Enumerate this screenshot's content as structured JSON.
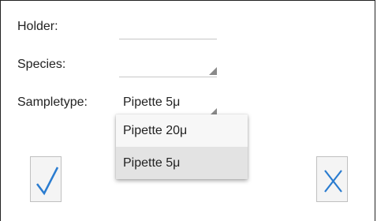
{
  "form": {
    "holder_label": "Holder:",
    "holder_value": "",
    "species_label": "Species:",
    "species_value": "",
    "sampletype_label": "Sampletype:",
    "sampletype_value": "Pipette 5μ"
  },
  "dropdown": {
    "options": [
      "Pipette 20μ",
      "Pipette 5μ"
    ],
    "selected_index": 1
  },
  "buttons": {
    "confirm_icon": "checkmark-icon",
    "cancel_icon": "close-icon",
    "accent_color": "#2a7cd0"
  }
}
